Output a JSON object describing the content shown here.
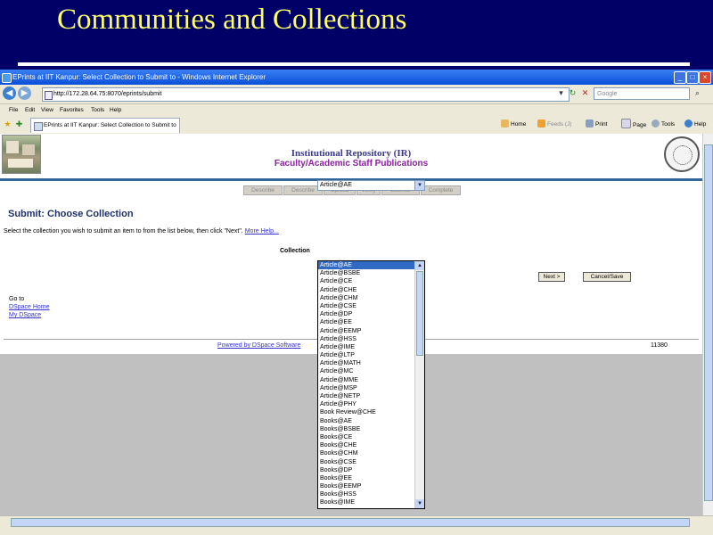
{
  "slide": {
    "title": "Communities and Collections"
  },
  "browser": {
    "window_title": "EPrints at IIT Kanpur: Select Collection to Submit to - Windows Internet Explorer",
    "address": "http://172.28.64.75:8070/eprints/submit",
    "search_placeholder": "Google",
    "menu": [
      "File",
      "Edit",
      "View",
      "Favorites",
      "Tools",
      "Help"
    ],
    "tab_title": "EPrints at IIT Kanpur: Select Collection to Submit to",
    "commands": [
      "Home",
      "Feeds (J)",
      "Print",
      "Page",
      "Tools",
      "Help"
    ]
  },
  "page": {
    "repo_title": "Institutional Repository (IR)",
    "repo_subtitle": "Faculty/Academic Staff Publications",
    "steps": [
      "Describe",
      "Describe",
      "Upload",
      "Verify",
      "License",
      "Complete"
    ],
    "heading": "Submit: Choose Collection",
    "instruction": "Select the collection you wish to submit an item to from the list below, then click \"Next\".",
    "more_help": "More Help...",
    "collection_label": "Collection",
    "selected_collection": "Article@AE",
    "collections": [
      "Article@AE",
      "Article@BSBE",
      "Article@CE",
      "Article@CHE",
      "Article@CHM",
      "Article@CSE",
      "Article@DP",
      "Article@EE",
      "Article@EEMP",
      "Article@HSS",
      "Article@IME",
      "Article@LTP",
      "Article@MATH",
      "Article@MC",
      "Article@MME",
      "Article@MSP",
      "Article@NETP",
      "Article@PHY",
      "Book Review@CHE",
      "Books@AE",
      "Books@BSBE",
      "Books@CE",
      "Books@CHE",
      "Books@CHM",
      "Books@CSE",
      "Books@DP",
      "Books@EE",
      "Books@EEMP",
      "Books@HSS",
      "Books@IME"
    ],
    "next_label": "Next >",
    "cancel_label": "Cancel/Save",
    "goto_label": "Go to",
    "dspace_home": "DSpace Home",
    "my_dspace": "My DSpace",
    "powered_by": "Powered by DSpace Software",
    "footer_number": "11380"
  },
  "icons": {
    "back": "back-arrow-icon",
    "forward": "forward-arrow-icon",
    "home": "home-icon",
    "feeds": "rss-icon",
    "print": "printer-icon",
    "page": "page-icon",
    "tools": "gear-icon",
    "help": "help-icon"
  }
}
